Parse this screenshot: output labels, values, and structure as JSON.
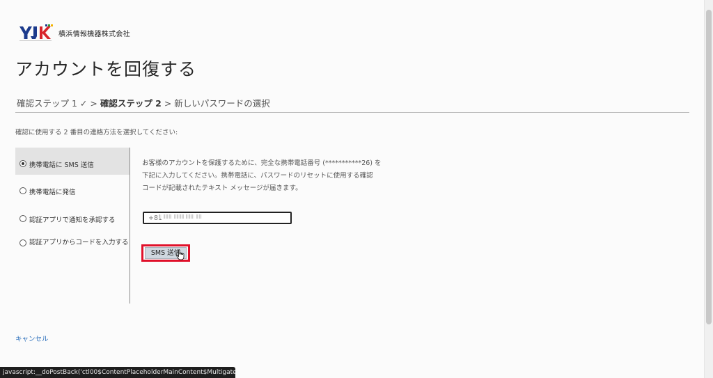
{
  "logo": {
    "letters": "YJK",
    "company_name": "横浜情報機器株式会社"
  },
  "page_title": "アカウントを回復する",
  "breadcrumb": {
    "step1": "確認ステップ 1 ✓ >",
    "step2": "確認ステップ 2",
    "step3": "> 新しいパスワードの選択"
  },
  "instruction": "確認に使用する 2 番目の連絡方法を選択してください:",
  "methods": [
    {
      "label": "携帯電話に SMS 送信",
      "selected": true
    },
    {
      "label": "携帯電話に発信",
      "selected": false
    },
    {
      "label": "認証アプリで通知を承認する",
      "selected": false
    },
    {
      "label": "認証アプリからコードを入力する",
      "selected": false
    }
  ],
  "detail": {
    "line1": "お客様のアカウントを保護するために、完全な携帯電話番号 (***********26) を",
    "line2": "下記に入力してください。携帯電話に、パスワードのリセットに使用する確認",
    "line3": "コードが記載されたテキスト メッセージが届きます。"
  },
  "phone_input": {
    "value": "+81"
  },
  "sms_button_label": "SMS 送信",
  "cancel_label": "キャンセル",
  "status_bar": "javascript:__doPostBack('ctl00$ContentPlaceholderMainContent$MultigateA...",
  "colors": {
    "link": "#2a6ebb",
    "highlight_border": "#e0102a",
    "selected_bg": "#e3e3e3",
    "logo_blue": "#1b3a8c",
    "logo_red": "#d8232a"
  },
  "icons": {
    "cursor": "hand-pointer-icon",
    "radio": "radio-button-icon"
  }
}
